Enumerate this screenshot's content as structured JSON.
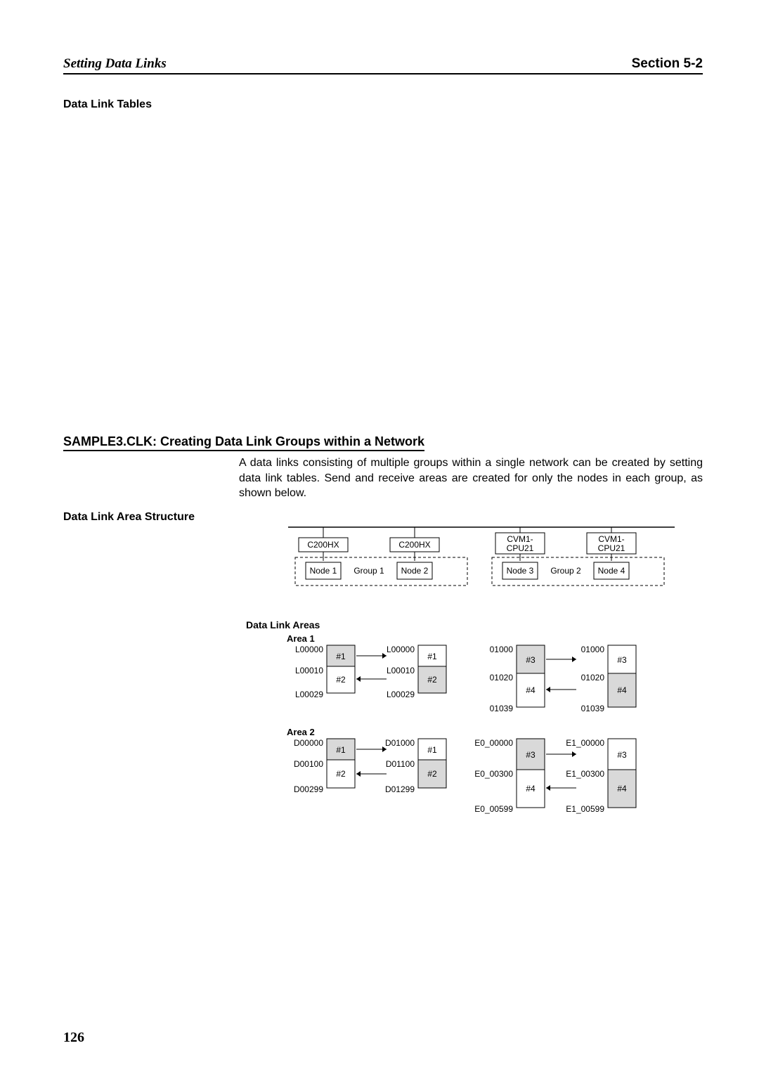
{
  "header": {
    "left": "Setting Data Links",
    "right": "Section 5-2"
  },
  "subheading": "Data Link Tables",
  "section_title": "SAMPLE3.CLK: Creating Data Link Groups within a Network",
  "body_text": "A data links consisting of multiple groups within a single network can be created by setting data link tables. Send and receive areas are created for only the nodes in each group, as shown below.",
  "side_heading": "Data Link Area Structure",
  "diagram": {
    "cpu": [
      "C200HX",
      "C200HX",
      "CVM1-\nCPU21",
      "CVM1-\nCPU21"
    ],
    "nodes": [
      "Node 1",
      "Node 2",
      "Node 3",
      "Node 4"
    ],
    "groups": [
      "Group 1",
      "Group 2"
    ],
    "areas_heading": "Data Link Areas",
    "area1": {
      "title": "Area 1",
      "labels_left": [
        "L00000",
        "L00010",
        "L00029"
      ],
      "labels_right": [
        "L00000",
        "L00010",
        "L00029"
      ],
      "labels_r1": [
        "01000",
        "01020",
        "01039"
      ],
      "labels_r2": [
        "01000",
        "01020",
        "01039"
      ],
      "cells_l": [
        "#1",
        "#2"
      ],
      "cells_r": [
        "#1",
        "#2"
      ],
      "cells_r1": [
        "#3",
        "#4"
      ],
      "cells_r2": [
        "#3",
        "#4"
      ]
    },
    "area2": {
      "title": "Area 2",
      "labels_left": [
        "D00000",
        "D00100",
        "D00299"
      ],
      "labels_right": [
        "D01000",
        "D01100",
        "D01299"
      ],
      "labels_r1": [
        "E0_00000",
        "E0_00300",
        "E0_00599"
      ],
      "labels_r2": [
        "E1_00000",
        "E1_00300",
        "E1_00599"
      ],
      "cells_l": [
        "#1",
        "#2"
      ],
      "cells_r": [
        "#1",
        "#2"
      ],
      "cells_r1": [
        "#3",
        "#4"
      ],
      "cells_r2": [
        "#3",
        "#4"
      ]
    }
  },
  "page_number": "126"
}
